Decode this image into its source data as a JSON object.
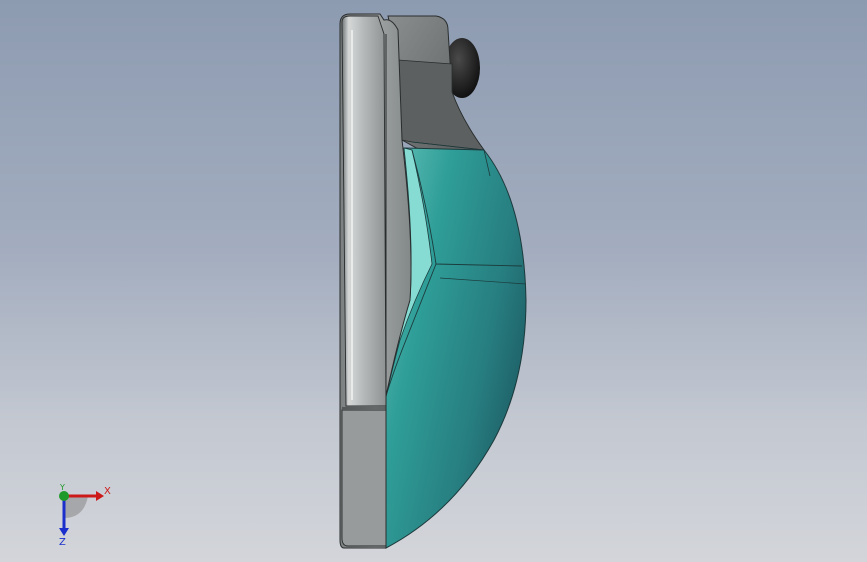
{
  "viewport": {
    "background_top": "#8d9bb1",
    "background_bottom": "#d3d5da"
  },
  "model": {
    "part_name": "handheld-pendant",
    "body_color": "#a8acac",
    "face_color": "#2f9e98",
    "face_highlight": "#7fd8cf",
    "knob_color": "#1c1c1c"
  },
  "triad": {
    "x_label": "X",
    "y_label": "Y",
    "z_label": "Z",
    "x_color": "#cc1a1a",
    "y_color": "#1e9a2a",
    "z_color": "#1a2fcc"
  }
}
